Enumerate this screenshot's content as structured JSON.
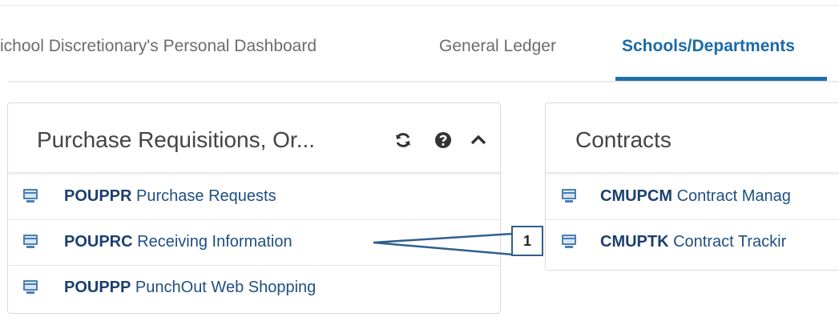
{
  "tabs": [
    {
      "label": "ichool Discretionary's Personal Dashboard",
      "active": false
    },
    {
      "label": "General Ledger",
      "active": false
    },
    {
      "label": "Schools/Departments",
      "active": true
    }
  ],
  "panels": {
    "left": {
      "title": "Purchase Requisitions, Or...",
      "controls": [
        "refresh-icon",
        "help-icon",
        "collapse-icon"
      ],
      "items": [
        {
          "code": "POUPPR",
          "label": "Purchase Requests"
        },
        {
          "code": "POUPRC",
          "label": "Receiving Information"
        },
        {
          "code": "POUPPP",
          "label": "PunchOut Web Shopping"
        }
      ]
    },
    "right": {
      "title": "Contracts",
      "items": [
        {
          "code": "CMUPCM",
          "label": "Contract Manag"
        },
        {
          "code": "CMUPTK",
          "label": "Contract Trackir"
        }
      ]
    }
  },
  "callout": {
    "number": "1"
  },
  "colors": {
    "accent": "#1e6fae",
    "link": "#1f4f83",
    "icon": "#4a7fb5"
  }
}
